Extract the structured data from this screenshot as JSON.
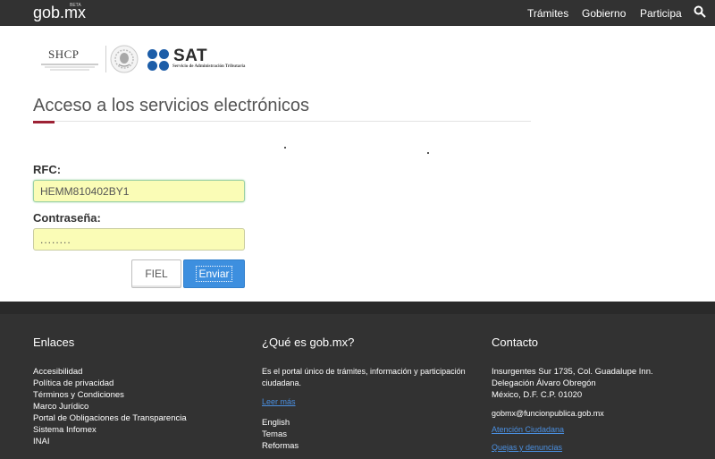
{
  "header": {
    "brand": "gob.mx",
    "brand_badge": "BETA",
    "nav": [
      "Trámites",
      "Gobierno",
      "Participa"
    ],
    "search_icon": "search-icon"
  },
  "logos": {
    "shcp": "SHCP",
    "sat": "SAT",
    "sat_subtitle": "Servicio de Administración Tributaria"
  },
  "main": {
    "title": "Acceso a los servicios electrónicos",
    "rfc_label": "RFC:",
    "rfc_value": "HEMM810402BY1",
    "password_label": "Contraseña:",
    "password_value": "........",
    "fiel_button": "FIEL",
    "enviar_button": "Enviar"
  },
  "footer": {
    "enlaces_title": "Enlaces",
    "enlaces": [
      "Accesibilidad",
      "Política de privacidad",
      "Términos y Condiciones",
      "Marco Jurídico",
      "Portal de Obligaciones de Transparencia",
      "Sistema Infomex",
      "INAI"
    ],
    "que_es_title": "¿Qué es gob.mx?",
    "que_es_text": "Es el portal único de trámites, información y participación ciudadana.",
    "leer_mas": "Leer más",
    "que_es_links": [
      "English",
      "Temas",
      "Reformas"
    ],
    "contacto_title": "Contacto",
    "address_1": "Insurgentes Sur 1735, Col. Guadalupe Inn.",
    "address_2": "Delegación Álvaro Obregón",
    "address_3": "México, D.F. C.P. 01020",
    "email": "gobmx@funcionpublica.gob.mx",
    "atencion": "Atención Ciudadana",
    "quejas": "Quejas y denuncias"
  },
  "colors": {
    "topbar": "#323232",
    "accent_red": "#9d2235",
    "button_blue": "#3d8fdf",
    "input_fill": "#fafcb6",
    "link_blue": "#4a8fe0"
  }
}
